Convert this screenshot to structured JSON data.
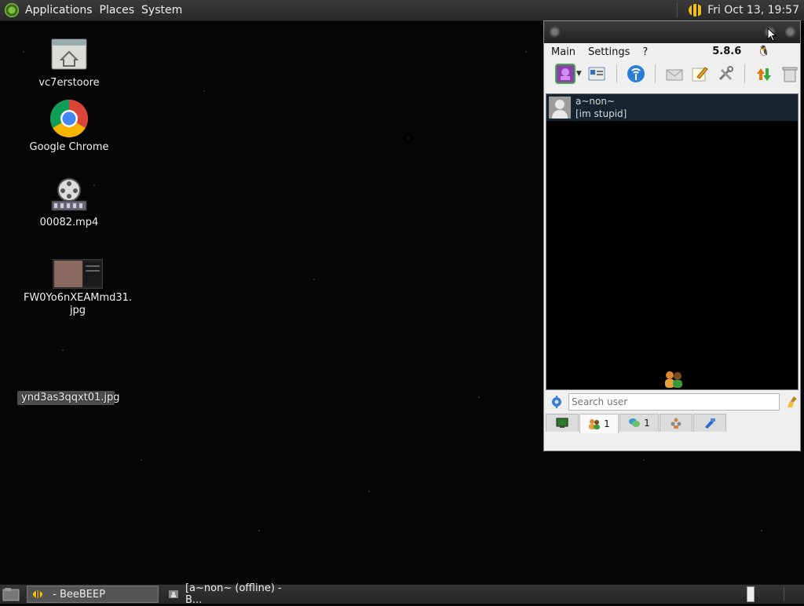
{
  "top_panel": {
    "menus": [
      "Applications",
      "Places",
      "System"
    ],
    "clock": "Fri Oct 13, 19:57"
  },
  "desktop_icons": [
    {
      "label": "vc7erstoore"
    },
    {
      "label": "Google Chrome"
    },
    {
      "label": "00082.mp4"
    },
    {
      "label": "FW0Yo6nXEAMmd31.\njpg"
    },
    {
      "label": "ynd3as3qqxt01.jpg"
    }
  ],
  "beebeep": {
    "menus": [
      "Main",
      "Settings",
      "?"
    ],
    "version": "5.8.6",
    "users": [
      {
        "name": "a~non~",
        "status": "[im stupid]"
      }
    ],
    "search_placeholder": "Search user",
    "tabs": [
      {
        "icon": "computer-icon",
        "label": ""
      },
      {
        "icon": "users-icon",
        "label": "1"
      },
      {
        "icon": "chat-icon",
        "label": "1"
      },
      {
        "icon": "groups-icon",
        "label": ""
      },
      {
        "icon": "share-icon",
        "label": ""
      }
    ]
  },
  "taskbar": {
    "tasks": [
      {
        "title": " - BeeBEEP"
      },
      {
        "title": "[a~non~ (offline) - B..."
      }
    ]
  },
  "colors": {
    "desktop_bg": "#050505",
    "panel_bg": "#2f2f2f",
    "window_bg": "#efefef",
    "selected_row": "#16242f"
  }
}
